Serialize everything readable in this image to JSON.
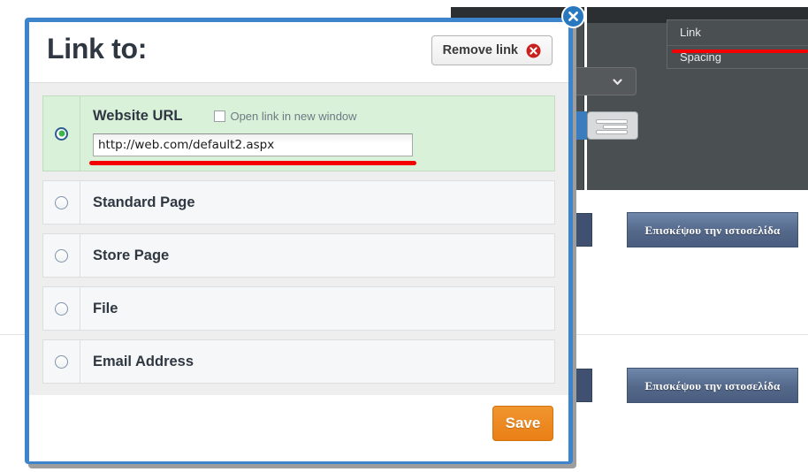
{
  "dialog": {
    "title": "Link to:",
    "remove_link_label": "Remove link",
    "save_label": "Save",
    "close_icon": "close-circle-icon",
    "border_color": "#3c85cd",
    "options": [
      {
        "id": "website-url",
        "label": "Website URL",
        "selected": true,
        "checkbox_label": "Open link in new window",
        "checkbox_checked": false,
        "input_value": "http://web.com/default2.aspx",
        "input_placeholder": "http://"
      },
      {
        "id": "standard-page",
        "label": "Standard Page",
        "selected": false
      },
      {
        "id": "store-page",
        "label": "Store Page",
        "selected": false
      },
      {
        "id": "file",
        "label": "File",
        "selected": false
      },
      {
        "id": "email-address",
        "label": "Email Address",
        "selected": false
      }
    ]
  },
  "background": {
    "menu": {
      "items": [
        {
          "label": "Link"
        },
        {
          "label": "Spacing"
        }
      ]
    },
    "toolbar": {
      "select_icon": "chevron-down-icon",
      "align_icon": "align-right-icon"
    },
    "cta_buttons": [
      {
        "label": "Επισκέψου την ιστοσελίδα"
      },
      {
        "label": "Επισκέψου την ιστοσελίδα"
      }
    ]
  },
  "annotations": {
    "accent_color": "#f50000",
    "url_underline": "red-underline-url",
    "menu_underline": "red-underline-link-menu"
  }
}
